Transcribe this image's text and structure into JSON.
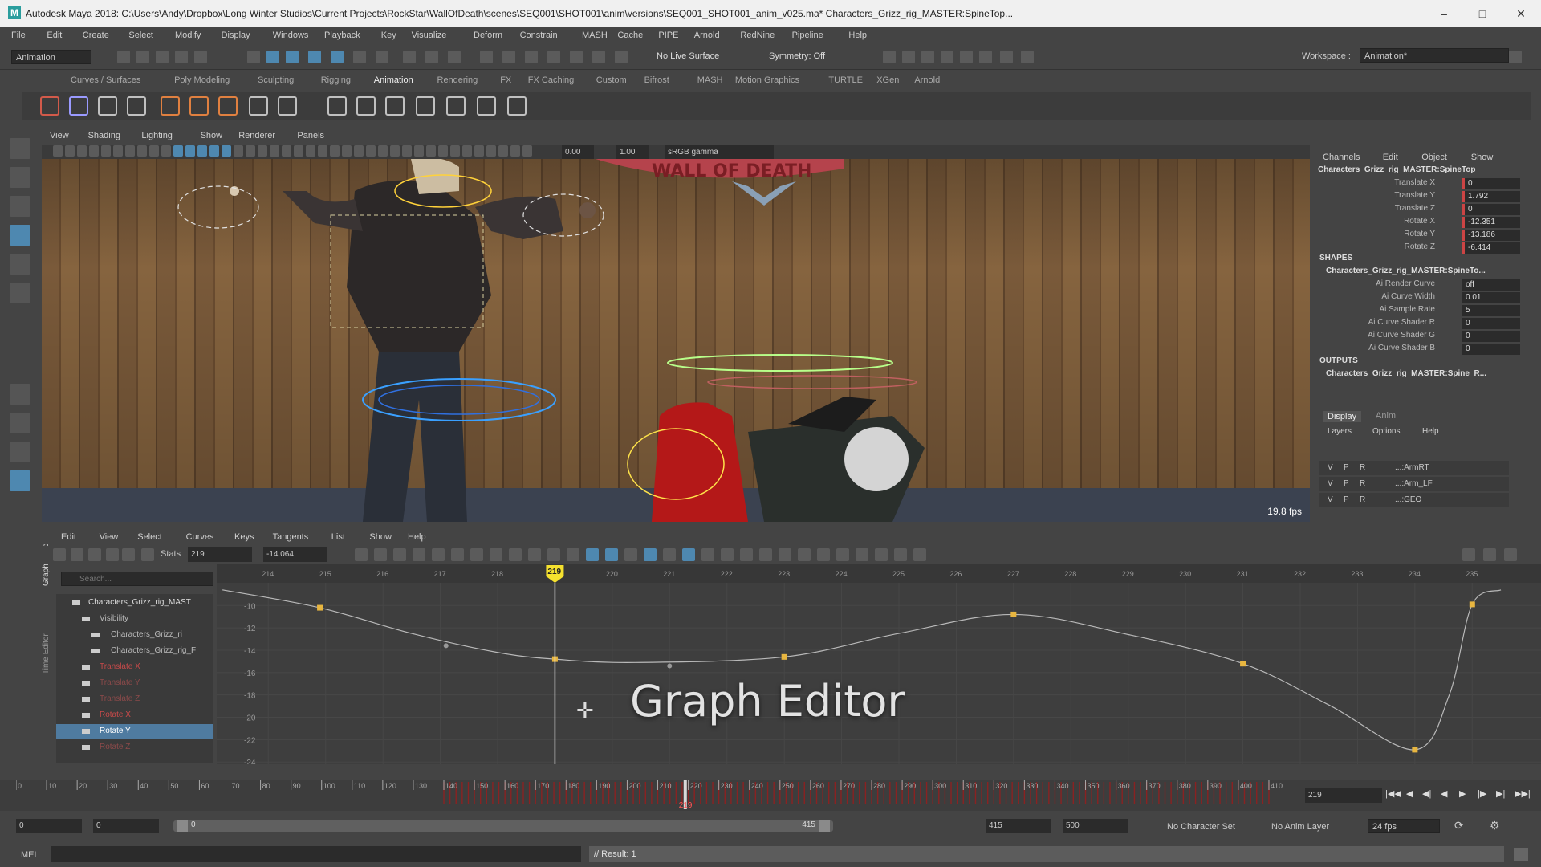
{
  "window": {
    "title": "Autodesk Maya 2018: C:\\Users\\Andy\\Dropbox\\Long Winter Studios\\Current Projects\\RockStar\\WallOfDeath\\scenes\\SEQ001\\SHOT001\\anim\\versions\\SEQ001_SHOT001_anim_v025.ma*    Characters_Grizz_rig_MASTER:SpineTop...",
    "logo": "M",
    "controls": [
      "–",
      "□",
      "✕"
    ]
  },
  "menubar": [
    "File",
    "Edit",
    "Create",
    "Select",
    "Modify",
    "Display",
    "Windows",
    "Playback",
    "Key",
    "Visualize",
    "Deform",
    "Constrain",
    "MASH",
    "Cache",
    "PIPE",
    "Arnold",
    "RedNine",
    "Pipeline",
    "Help"
  ],
  "statusline": {
    "menuset": "Animation",
    "live_surface": "No Live Surface",
    "symmetry": "Symmetry: Off",
    "workspace_label": "Workspace :",
    "workspace_value": "Animation*"
  },
  "shelf_tabs": [
    "Curves / Surfaces",
    "Poly Modeling",
    "Sculpting",
    "Rigging",
    "Animation",
    "Rendering",
    "FX",
    "FX Caching",
    "Custom",
    "Bifrost",
    "MASH",
    "Motion Graphics",
    "TURTLE",
    "XGen",
    "Arnold"
  ],
  "active_shelf_tab": "Animation",
  "viewport": {
    "menu": [
      "View",
      "Shading",
      "Lighting",
      "Show",
      "Renderer",
      "Panels"
    ],
    "exposure": "0.00",
    "gamma": "1.00",
    "color_space": "sRGB gamma",
    "fps": "19.8 fps",
    "banner_text": "WALL OF DEATH"
  },
  "channel_box": {
    "tabs": [
      "Channels",
      "Edit",
      "Object",
      "Show"
    ],
    "object_name": "Characters_Grizz_rig_MASTER:SpineTop",
    "channels": [
      {
        "label": "Translate X",
        "value": "0"
      },
      {
        "label": "Translate Y",
        "value": "1.792"
      },
      {
        "label": "Translate Z",
        "value": "0"
      },
      {
        "label": "Rotate X",
        "value": "-12.351"
      },
      {
        "label": "Rotate Y",
        "value": "-13.186"
      },
      {
        "label": "Rotate Z",
        "value": "-6.414"
      }
    ],
    "shapes_header": "SHAPES",
    "shape_name": "Characters_Grizz_rig_MASTER:SpineTo...",
    "shape_attrs": [
      {
        "label": "Ai Render Curve",
        "value": "off"
      },
      {
        "label": "Ai Curve Width",
        "value": "0.01"
      },
      {
        "label": "Ai Sample Rate",
        "value": "5"
      },
      {
        "label": "Ai Curve Shader R",
        "value": "0"
      },
      {
        "label": "Ai Curve Shader G",
        "value": "0"
      },
      {
        "label": "Ai Curve Shader B",
        "value": "0"
      }
    ],
    "outputs_header": "OUTPUTS",
    "output_name": "Characters_Grizz_rig_MASTER:Spine_R...",
    "layer_tabs": [
      "Display",
      "Anim"
    ],
    "layer_menu": [
      "Layers",
      "Options",
      "Help"
    ],
    "layers": [
      {
        "v": "V",
        "p": "P",
        "r": "R",
        "name": "...:ArmRT"
      },
      {
        "v": "V",
        "p": "P",
        "r": "R",
        "name": "...:Arm_LF"
      },
      {
        "v": "V",
        "p": "P",
        "r": "R",
        "name": "...:GEO"
      }
    ]
  },
  "graph_editor": {
    "side_tabs": [
      "Graph Editor",
      "Time Editor"
    ],
    "menu": [
      "Edit",
      "View",
      "Select",
      "Curves",
      "Keys",
      "Tangents",
      "List",
      "Show",
      "Help"
    ],
    "stats_label": "Stats",
    "stats_frame": "219",
    "stats_value": "-14.064",
    "search_placeholder": "Search...",
    "outliner": [
      {
        "label": "Characters_Grizz_rig_MAST",
        "indent": 0,
        "color": "#dddddd"
      },
      {
        "label": "Visibility",
        "indent": 1,
        "color": "#bbbbbb"
      },
      {
        "label": "Characters_Grizz_ri",
        "indent": 2,
        "color": "#bbbbbb"
      },
      {
        "label": "Characters_Grizz_rig_F",
        "indent": 2,
        "color": "#bbbbbb"
      },
      {
        "label": "Translate X",
        "indent": 1,
        "color": "#c84a4a"
      },
      {
        "label": "Translate Y",
        "indent": 1,
        "color": "#8c4a4a"
      },
      {
        "label": "Translate Z",
        "indent": 1,
        "color": "#8c4a4a"
      },
      {
        "label": "Rotate X",
        "indent": 1,
        "color": "#c84a4a"
      },
      {
        "label": "Rotate Y",
        "indent": 1,
        "color": "#ffffff"
      },
      {
        "label": "Rotate Z",
        "indent": 1,
        "color": "#8c4a4a"
      }
    ],
    "selected_index": 8,
    "current_frame_label": "219",
    "overlay_title": "Graph Editor"
  },
  "chart_data": {
    "type": "line",
    "x_ticks": [
      "214",
      "215",
      "216",
      "217",
      "218",
      "219",
      "220",
      "221",
      "222",
      "223",
      "224",
      "225",
      "226",
      "227",
      "228",
      "229",
      "230",
      "231",
      "232",
      "233",
      "234",
      "235"
    ],
    "y_ticks": [
      "-10",
      "-12",
      "-14",
      "-16",
      "-18",
      "-20",
      "-22",
      "-24"
    ],
    "xlim": [
      213.1,
      236.2
    ],
    "ylim": [
      -24.2,
      -8.4
    ],
    "keys": [
      {
        "x": 214.9,
        "y": -10.2
      },
      {
        "x": 219.0,
        "y": -14.8
      },
      {
        "x": 223.0,
        "y": -14.6
      },
      {
        "x": 227.0,
        "y": -10.8
      },
      {
        "x": 231.0,
        "y": -15.2
      },
      {
        "x": 234.0,
        "y": -22.9
      },
      {
        "x": 235.0,
        "y": -9.9
      }
    ],
    "curve": [
      {
        "x": 213.2,
        "y": -8.6
      },
      {
        "x": 214.9,
        "y": -10.2
      },
      {
        "x": 216.5,
        "y": -12.5
      },
      {
        "x": 218.0,
        "y": -14.2
      },
      {
        "x": 219.0,
        "y": -14.8
      },
      {
        "x": 220.4,
        "y": -15.1
      },
      {
        "x": 223.0,
        "y": -14.6
      },
      {
        "x": 225.0,
        "y": -12.5
      },
      {
        "x": 227.0,
        "y": -10.8
      },
      {
        "x": 229.0,
        "y": -12.6
      },
      {
        "x": 231.0,
        "y": -15.2
      },
      {
        "x": 232.5,
        "y": -18.9
      },
      {
        "x": 234.0,
        "y": -22.9
      },
      {
        "x": 234.6,
        "y": -18.0
      },
      {
        "x": 235.0,
        "y": -9.9
      },
      {
        "x": 235.5,
        "y": -8.6
      }
    ],
    "current_frame": 219
  },
  "time_slider": {
    "ticks": [
      "0",
      "10",
      "20",
      "30",
      "40",
      "50",
      "60",
      "70",
      "80",
      "90",
      "100",
      "110",
      "120",
      "130",
      "140",
      "150",
      "160",
      "170",
      "180",
      "190",
      "200",
      "210",
      "220",
      "230",
      "240",
      "250",
      "260",
      "270",
      "280",
      "290",
      "300",
      "310",
      "320",
      "330",
      "340",
      "350",
      "360",
      "370",
      "380",
      "390",
      "400",
      "410"
    ],
    "current_frame": "219",
    "current_frame_field": "219",
    "playback_buttons": [
      "|◀◀",
      "|◀",
      "◀|",
      "◀",
      "▶",
      "|▶",
      "▶|",
      "▶▶|"
    ]
  },
  "range_slider": {
    "start": "0",
    "anim_start": "0",
    "range_start": "0",
    "range_end": "415",
    "anim_end": "415",
    "end": "500",
    "character_set": "No Character Set",
    "anim_layer": "No Anim Layer",
    "fps": "24 fps"
  },
  "command_line": {
    "language": "MEL",
    "result": "// Result: 1"
  }
}
